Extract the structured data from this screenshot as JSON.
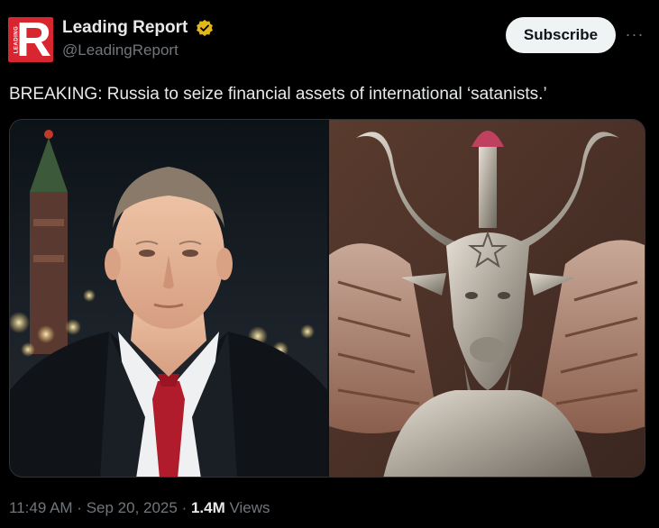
{
  "account": {
    "display_name": "Leading Report",
    "handle": "@LeadingReport",
    "avatar_letter": "R",
    "avatar_vertical_text": "LEADING",
    "verified_badge_color": "#e2b719",
    "avatar_color": "#d7262f"
  },
  "actions": {
    "subscribe_label": "Subscribe",
    "more_label": "···"
  },
  "tweet": {
    "text": "BREAKING: Russia to seize financial assets of international ‘satanists.’"
  },
  "media": {
    "left_image": "photo of man in dark suit and red tie, Kremlin night background",
    "right_image": "photo of silver horned goat-headed statue with wings"
  },
  "meta": {
    "time": "11:49 AM",
    "separator": " · ",
    "date": "Sep 20, 2025",
    "views_count": "1.4M",
    "views_label": "Views"
  }
}
